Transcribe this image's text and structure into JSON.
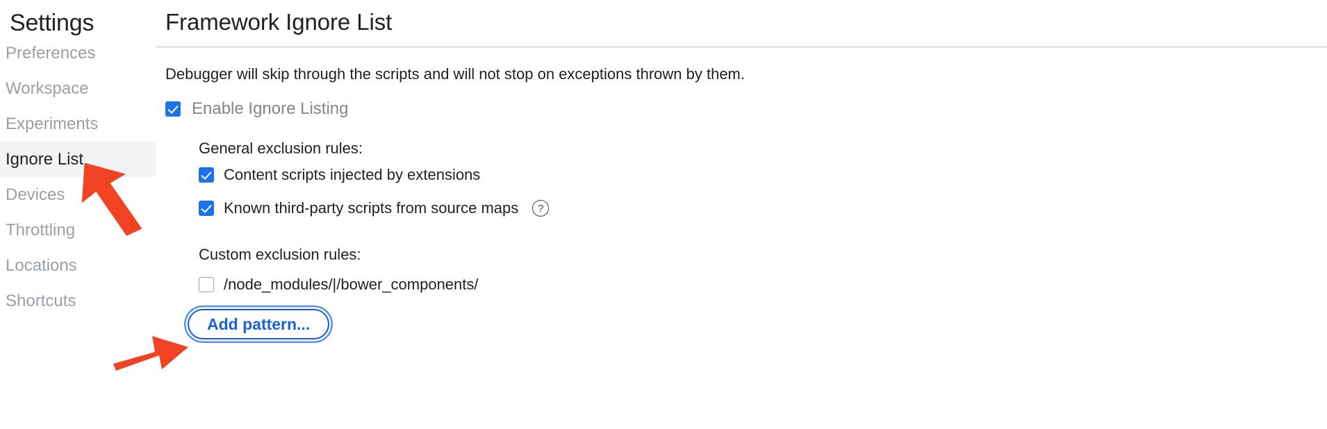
{
  "sidebar": {
    "title": "Settings",
    "items": [
      {
        "label": "Preferences",
        "selected": false
      },
      {
        "label": "Workspace",
        "selected": false
      },
      {
        "label": "Experiments",
        "selected": false
      },
      {
        "label": "Ignore List",
        "selected": true
      },
      {
        "label": "Devices",
        "selected": false
      },
      {
        "label": "Throttling",
        "selected": false
      },
      {
        "label": "Locations",
        "selected": false
      },
      {
        "label": "Shortcuts",
        "selected": false
      }
    ]
  },
  "main": {
    "page_title": "Framework Ignore List",
    "description": "Debugger will skip through the scripts and will not stop on exceptions thrown by them.",
    "enable": {
      "label": "Enable Ignore Listing",
      "checked": true
    },
    "general_section": {
      "heading": "General exclusion rules:",
      "rules": [
        {
          "label": "Content scripts injected by extensions",
          "checked": true,
          "help": false
        },
        {
          "label": "Known third-party scripts from source maps",
          "checked": true,
          "help": true,
          "help_glyph": "?"
        }
      ]
    },
    "custom_section": {
      "heading": "Custom exclusion rules:",
      "rules": [
        {
          "label": "/node_modules/|/bower_components/",
          "checked": false
        }
      ],
      "add_button_label": "Add pattern..."
    }
  },
  "annotations": [
    {
      "name": "arrow-pointing-to-ignore-list",
      "color": "#ef4323"
    },
    {
      "name": "arrow-pointing-to-custom-rule-checkbox",
      "color": "#ef4323"
    }
  ],
  "colors": {
    "accent_blue": "#1a73e8",
    "button_blue": "#1a64d8",
    "selected_row_bg": "#f1f3f4",
    "muted_text": "#9aa0a6",
    "divider": "#e6e6f0",
    "annotation_red": "#ef4323"
  }
}
